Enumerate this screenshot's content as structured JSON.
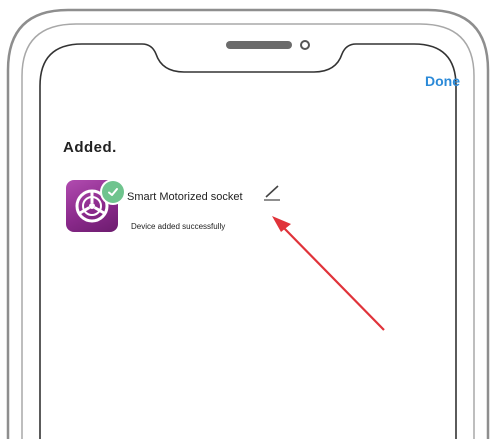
{
  "header": {
    "done_label": "Done"
  },
  "page": {
    "title": "Added."
  },
  "device": {
    "name": "Smart Motorized socket",
    "status": "Device added successfully",
    "icon": "steering-wheel-icon",
    "badge_icon": "check-icon",
    "edit_icon": "pencil-icon"
  },
  "colors": {
    "accent": "#2b8ad8",
    "icon_bg": "#8b2a8c",
    "badge": "#6fc48e",
    "arrow": "#e0333a"
  }
}
